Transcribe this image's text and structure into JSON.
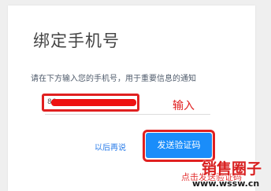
{
  "dialog": {
    "title": "绑定手机号",
    "hint": "请在下方输入您的手机号，用于重要信息的通知",
    "phone_value": "86",
    "phone_placeholder": "",
    "later_label": "以后再说",
    "send_label": "发送验证码"
  },
  "annotations": {
    "input_note": "输入",
    "click_note": "点击发送验证码"
  },
  "watermark": {
    "logo": "销售圈子",
    "url": "www.wssw.cn"
  },
  "colors": {
    "primary": "#1a8dfa",
    "annotation": "#e02020",
    "link": "#2b7de9"
  }
}
